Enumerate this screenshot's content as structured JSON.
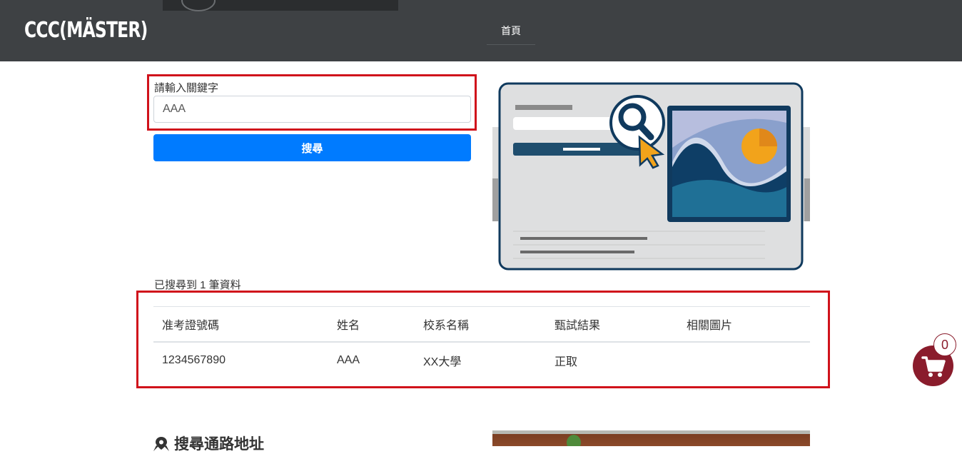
{
  "navbar": {
    "logo_text": "CCC(MÄSTER)",
    "home_label": "首頁"
  },
  "search": {
    "label": "請輸入關鍵字",
    "value": "AAA",
    "button_label": "搜尋"
  },
  "results": {
    "count_text": "已搜尋到 1 筆資料",
    "headers": [
      "准考證號碼",
      "姓名",
      "校系名稱",
      "甄試結果",
      "相關圖片"
    ],
    "rows": [
      [
        "1234567890",
        "AAA",
        "XX大學",
        "正取",
        ""
      ]
    ]
  },
  "cart": {
    "count": "0"
  },
  "section": {
    "heading": "搜尋通路地址"
  },
  "colors": {
    "navbar_bg": "#3e4144",
    "primary_button": "#007bff",
    "highlight_border": "#d0121b",
    "cart_bg": "#8a1c2c"
  }
}
